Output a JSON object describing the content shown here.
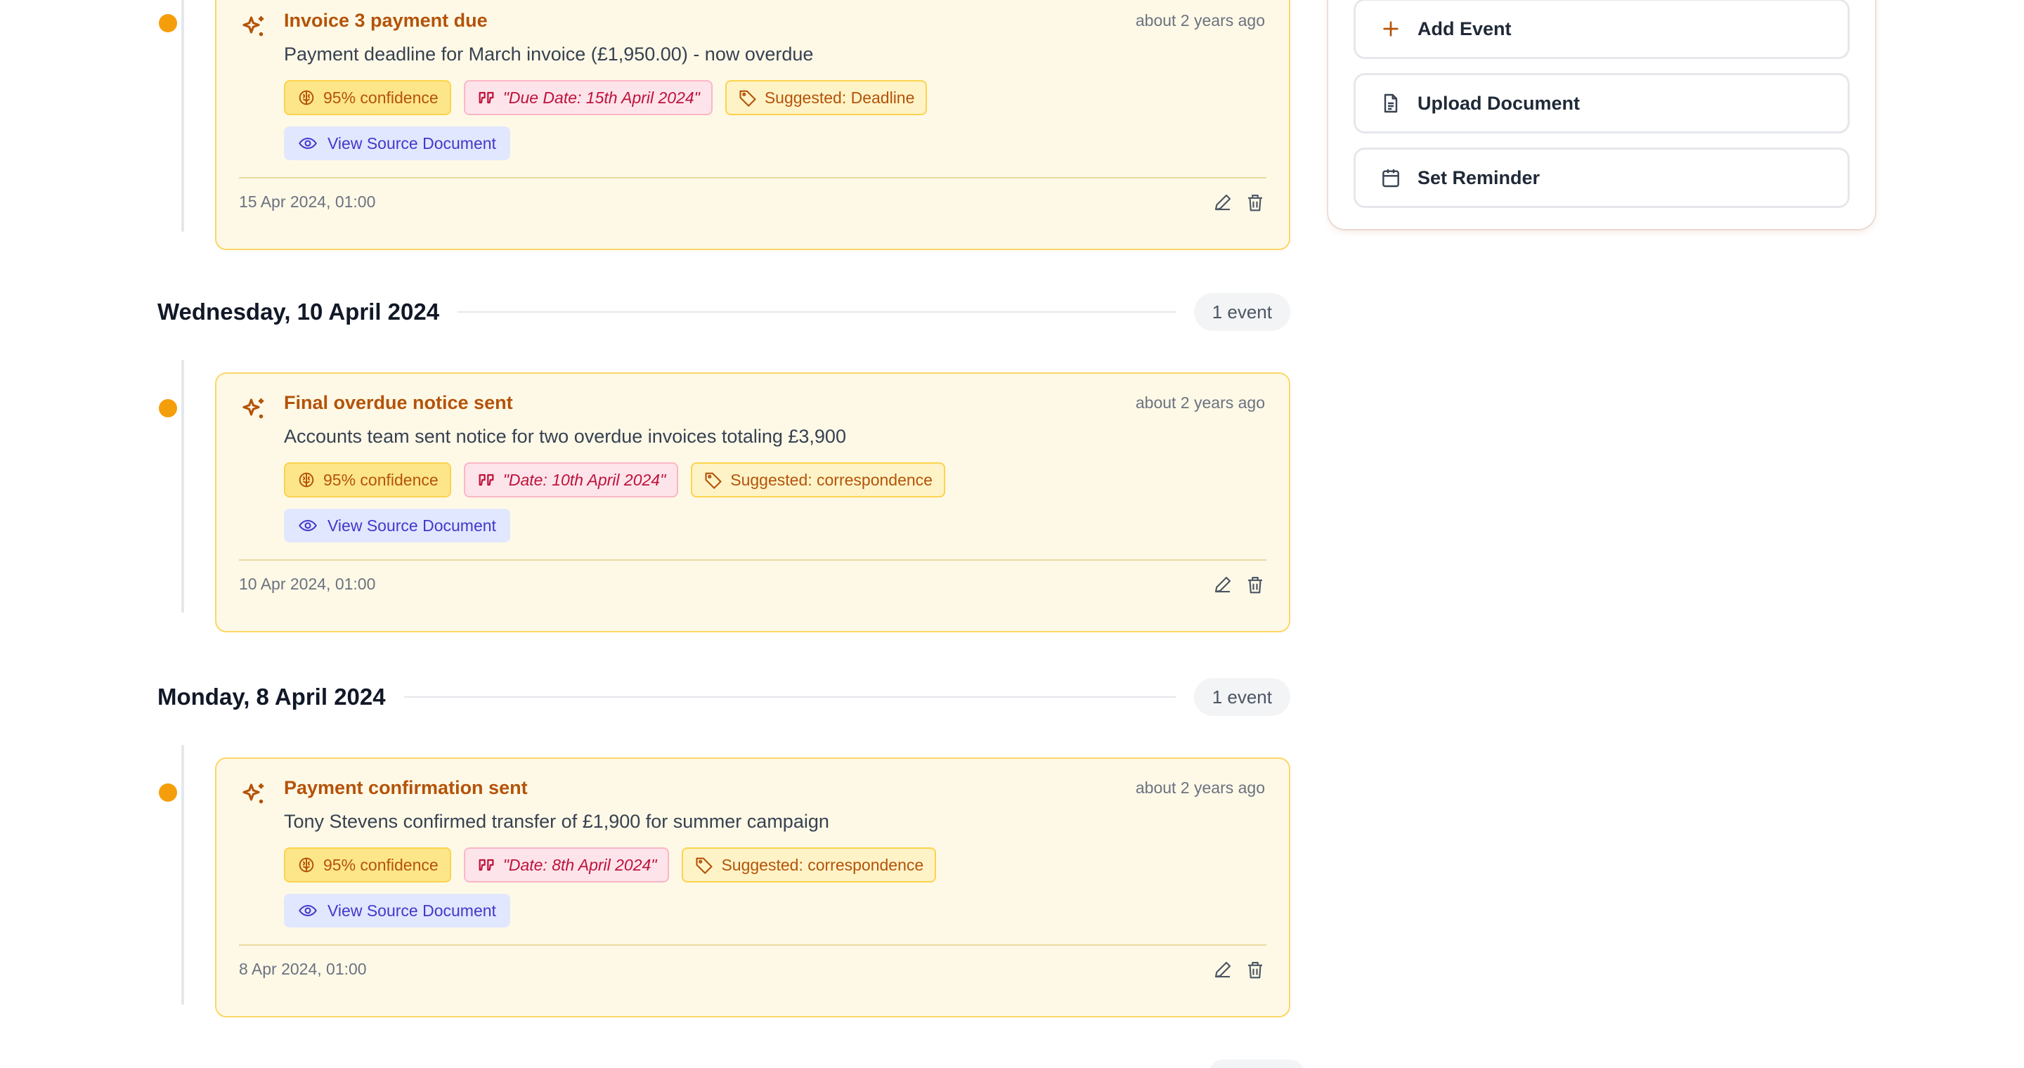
{
  "sidebar": {
    "buttons": [
      {
        "label": "Add Event",
        "icon": "plus-icon"
      },
      {
        "label": "Upload Document",
        "icon": "document-icon"
      },
      {
        "label": "Set Reminder",
        "icon": "calendar-icon"
      }
    ]
  },
  "groups": [
    {
      "date": "Wednesday, 10 April 2024",
      "count": "1 event"
    },
    {
      "date": "Monday, 8 April 2024",
      "count": "1 event"
    }
  ],
  "events": [
    {
      "title": "Invoice 3 payment due",
      "ago": "about 2 years ago",
      "description": "Payment deadline for March invoice (£1,950.00) - now overdue",
      "confidence": "95% confidence",
      "quote": "\"Due Date: 15th April 2024\"",
      "suggested": "Suggested: Deadline",
      "view_source": "View Source Document",
      "timestamp": "15 Apr 2024, 01:00"
    },
    {
      "title": "Final overdue notice sent",
      "ago": "about 2 years ago",
      "description": "Accounts team sent notice for two overdue invoices totaling £3,900",
      "confidence": "95% confidence",
      "quote": "\"Date: 10th April 2024\"",
      "suggested": "Suggested: correspondence",
      "view_source": "View Source Document",
      "timestamp": "10 Apr 2024, 01:00"
    },
    {
      "title": "Payment confirmation sent",
      "ago": "about 2 years ago",
      "description": "Tony Stevens confirmed transfer of £1,900 for summer campaign",
      "confidence": "95% confidence",
      "quote": "\"Date: 8th April 2024\"",
      "suggested": "Suggested: correspondence",
      "view_source": "View Source Document",
      "timestamp": "8 Apr 2024, 01:00"
    }
  ],
  "colors": {
    "accent": "#b45309",
    "dot": "#f59e0b",
    "card_bg": "#fef9e7",
    "card_border": "#fcd667"
  }
}
